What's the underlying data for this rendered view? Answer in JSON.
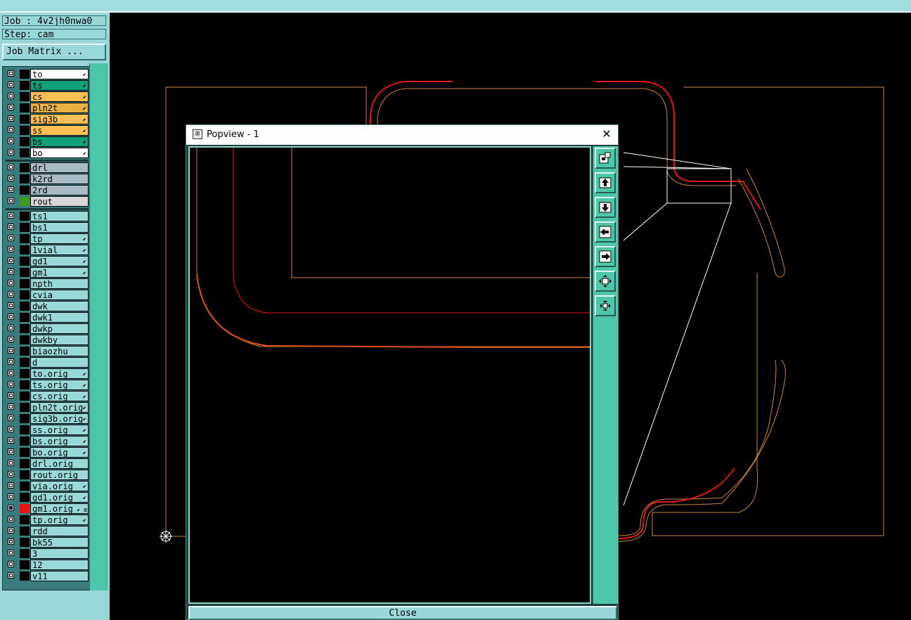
{
  "job_label": "Job : 4v2jh0nwa0",
  "step_label": "Step: cam",
  "job_matrix_button": "Job Matrix ...",
  "layers_board": [
    {
      "name": "to",
      "color": "#ffffff",
      "mark": "⬋"
    },
    {
      "name": "ts",
      "color": "#11a078",
      "mark": "⬋"
    },
    {
      "name": "cs",
      "color": "#ffc056",
      "mark": "⬋"
    },
    {
      "name": "pln2t",
      "color": "#e8b040",
      "mark": "⬋"
    },
    {
      "name": "sig3b",
      "color": "#ffc056",
      "mark": "⬋"
    },
    {
      "name": "ss",
      "color": "#ffc056",
      "mark": "⬋"
    },
    {
      "name": "bs",
      "color": "#11a078",
      "mark": "⬋"
    },
    {
      "name": "bo",
      "color": "#ffffff",
      "mark": "⬋"
    }
  ],
  "layers_drill": [
    {
      "name": "drl",
      "color": "#a9bcc6",
      "mark": ""
    },
    {
      "name": "k2rd",
      "color": "#a9bcc6",
      "mark": ""
    },
    {
      "name": "2rd",
      "color": "#a9bcc6",
      "mark": ""
    },
    {
      "name": "rout",
      "color": "#d8d8d8",
      "mark": "",
      "swatch": "#3f9a1e"
    }
  ],
  "layers_misc": [
    {
      "name": "ts1",
      "mark": ""
    },
    {
      "name": "bs1",
      "mark": ""
    },
    {
      "name": "tp",
      "mark": "⬋"
    },
    {
      "name": "1vial",
      "mark": "⬋"
    },
    {
      "name": "gd1",
      "mark": "⬋"
    },
    {
      "name": "gm1",
      "mark": "⬋"
    },
    {
      "name": "npth",
      "mark": ""
    },
    {
      "name": "cvia",
      "mark": ""
    },
    {
      "name": "dwk",
      "mark": ""
    },
    {
      "name": "dwk1",
      "mark": ""
    },
    {
      "name": "dwkp",
      "mark": ""
    },
    {
      "name": "dwkby",
      "mark": ""
    },
    {
      "name": "biaozhu",
      "mark": ""
    },
    {
      "name": "d",
      "mark": ""
    },
    {
      "name": "to.orig",
      "mark": "⬋"
    },
    {
      "name": "ts.orig",
      "mark": "⬋"
    },
    {
      "name": "cs.orig",
      "mark": "⬋"
    },
    {
      "name": "pln2t.orig",
      "mark": "⬋"
    },
    {
      "name": "sig3b.orig",
      "mark": "⬋"
    },
    {
      "name": "ss.orig",
      "mark": "⬋"
    },
    {
      "name": "bs.orig",
      "mark": "⬋"
    },
    {
      "name": "bo.orig",
      "mark": "⬋"
    },
    {
      "name": "drl.orig",
      "mark": ""
    },
    {
      "name": "rout.orig",
      "mark": ""
    },
    {
      "name": "via.orig",
      "mark": "⬋"
    },
    {
      "name": "gd1.orig",
      "mark": "⬋"
    },
    {
      "name": "gm1.orig",
      "mark": "⬋ ⊞",
      "selected": true,
      "swatch": "#ee1111"
    },
    {
      "name": "tp.orig",
      "mark": "⬋"
    },
    {
      "name": "rdd",
      "mark": ""
    },
    {
      "name": "bk55",
      "mark": ""
    },
    {
      "name": "3",
      "mark": ""
    },
    {
      "name": "12",
      "mark": ""
    },
    {
      "name": "v11",
      "mark": ""
    }
  ],
  "popview": {
    "title": "Popview - 1",
    "close_label": "Close",
    "tools": [
      "zoom-box-icon",
      "pan-up-icon",
      "pan-down-icon",
      "pan-left-icon",
      "pan-right-icon",
      "zoom-in-icon",
      "zoom-out-icon"
    ]
  },
  "colors": {
    "panel": "#9ad8d8",
    "scrollbar": "#4ec7a9",
    "outline_orange": "#c9843d",
    "trace_red": "#e01515"
  }
}
